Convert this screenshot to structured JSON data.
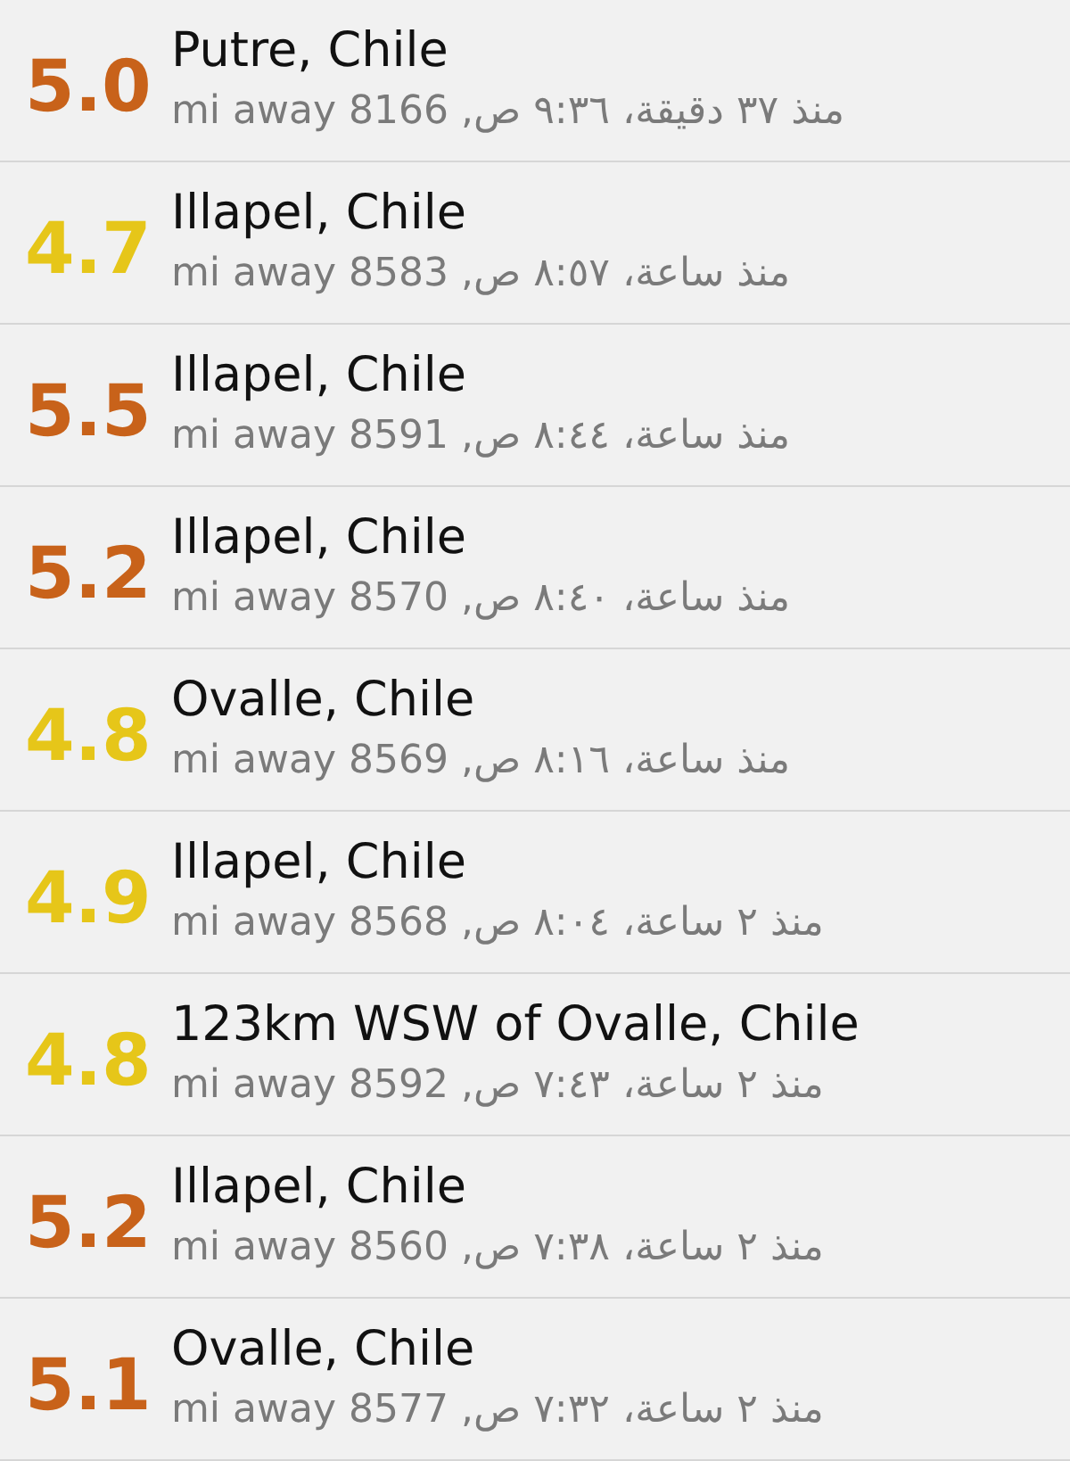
{
  "quakes": [
    {
      "magnitude": "5.0",
      "color": "#c8621a",
      "place": "Putre, Chile",
      "detail": "منذ ٣٧ دقيقة، ٩:٣٦ ص, 8166 mi away"
    },
    {
      "magnitude": "4.7",
      "color": "#e6c619",
      "place": "Illapel, Chile",
      "detail": "منذ ساعة، ٨:٥٧ ص, 8583 mi away"
    },
    {
      "magnitude": "5.5",
      "color": "#c8621a",
      "place": "Illapel, Chile",
      "detail": "منذ ساعة، ٨:٤٤ ص, 8591 mi away"
    },
    {
      "magnitude": "5.2",
      "color": "#c8621a",
      "place": "Illapel, Chile",
      "detail": "منذ ساعة، ٨:٤٠ ص, 8570 mi away"
    },
    {
      "magnitude": "4.8",
      "color": "#e6c619",
      "place": "Ovalle, Chile",
      "detail": "منذ ساعة، ٨:١٦ ص, 8569 mi away"
    },
    {
      "magnitude": "4.9",
      "color": "#e6c619",
      "place": "Illapel, Chile",
      "detail": "منذ ٢ ساعة، ٨:٠٤ ص, 8568 mi away"
    },
    {
      "magnitude": "4.8",
      "color": "#e6c619",
      "place": "123km WSW of Ovalle, Chile",
      "detail": "منذ ٢ ساعة، ٧:٤٣ ص, 8592 mi away"
    },
    {
      "magnitude": "5.2",
      "color": "#c8621a",
      "place": "Illapel, Chile",
      "detail": "منذ ٢ ساعة، ٧:٣٨ ص, 8560 mi away"
    },
    {
      "magnitude": "5.1",
      "color": "#c8621a",
      "place": "Ovalle, Chile",
      "detail": "منذ ٢ ساعة، ٧:٣٢ ص, 8577 mi away"
    }
  ]
}
